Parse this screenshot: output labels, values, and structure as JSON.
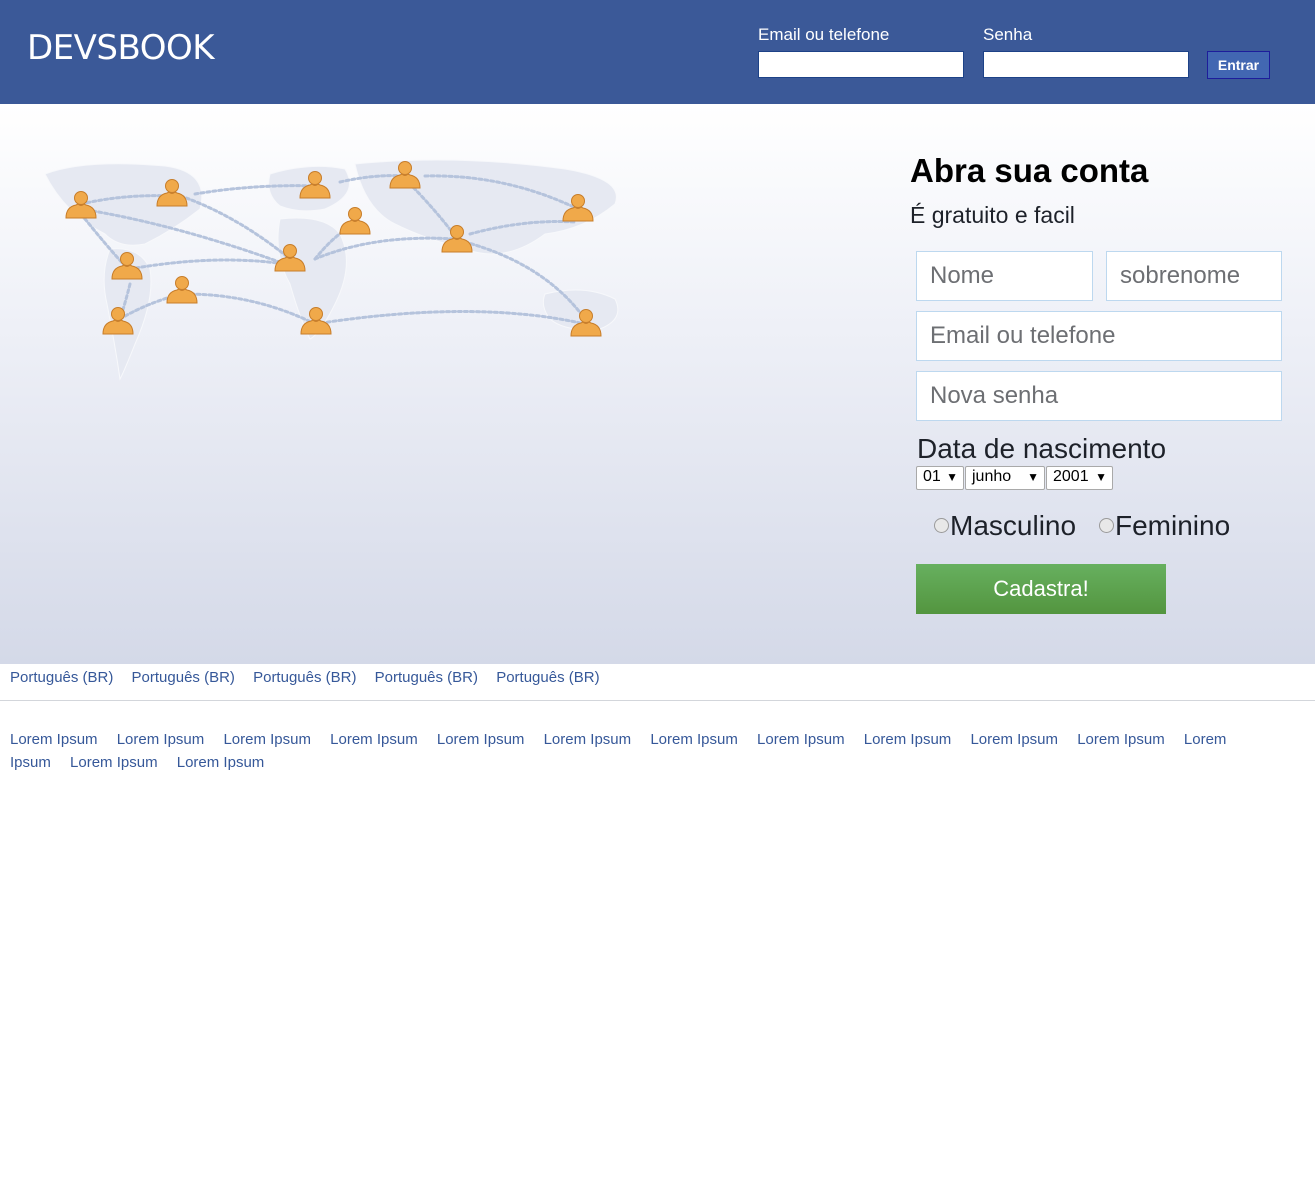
{
  "header": {
    "logo": "DEVSBOOK",
    "email_label": "Email ou telefone",
    "password_label": "Senha",
    "login_button": "Entrar"
  },
  "signup": {
    "title": "Abra sua conta",
    "subtitle": "É gratuito e facil",
    "first_name_placeholder": "Nome",
    "last_name_placeholder": "sobrenome",
    "email_placeholder": "Email ou telefone",
    "password_placeholder": "Nova senha",
    "birthdate_label": "Data de nascimento",
    "birth_day": "01",
    "birth_month": "junho",
    "birth_year": "2001",
    "gender_male": "Masculino",
    "gender_female": "Feminino",
    "submit_button": "Cadastra!"
  },
  "footer": {
    "languages": [
      "Português (BR)",
      "Português (BR)",
      "Português (BR)",
      "Português (BR)",
      "Português (BR)"
    ],
    "links": [
      "Lorem Ipsum",
      "Lorem Ipsum",
      "Lorem Ipsum",
      "Lorem Ipsum",
      "Lorem Ipsum",
      "Lorem Ipsum",
      "Lorem Ipsum",
      "Lorem Ipsum",
      "Lorem Ipsum",
      "Lorem Ipsum",
      "Lorem Ipsum",
      "Lorem Ipsum",
      "Lorem Ipsum",
      "Lorem Ipsum"
    ]
  },
  "colors": {
    "header_bg": "#3b5998",
    "link": "#365899",
    "submit_green": "#5ba24e",
    "person_icon": "#f0a94a"
  }
}
